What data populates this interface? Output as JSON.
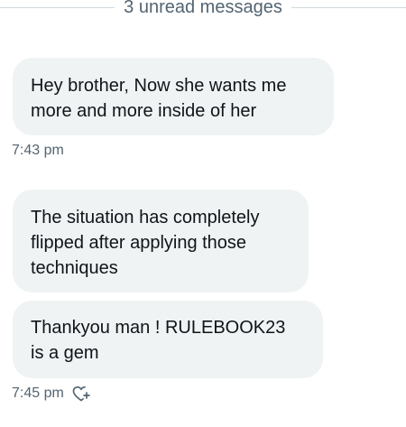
{
  "divider": {
    "label": "3 unread messages"
  },
  "messages": [
    {
      "lines": [
        "Hey brother, Now she wants me",
        "more and more inside of her"
      ]
    },
    {
      "lines": [
        "The situation has completely",
        "flipped after applying those",
        "techniques"
      ]
    },
    {
      "lines": [
        "Thankyou man ! RULEBOOK23",
        "is a gem"
      ]
    }
  ],
  "timestamps": [
    "7:43 pm",
    "7:45 pm"
  ],
  "icons": {
    "reaction": "add-reaction-heart-icon"
  },
  "colors": {
    "bubble_bg": "#eff3f4",
    "secondary_text": "#536471",
    "divider_line": "#cfd9de"
  }
}
